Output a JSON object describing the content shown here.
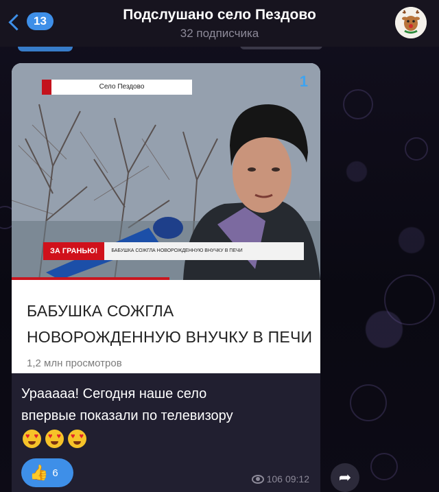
{
  "header": {
    "back_count": "13",
    "title": "Подслушано село Пездово",
    "subtitle": "32 подписчика"
  },
  "post": {
    "media": {
      "location_tag": "Село Пездово",
      "ticker_label": "ЗА ГРАНЬЮ!",
      "ticker_text": "БАБУШКА СОЖГЛА НОВОРОЖДЕННУЮ ВНУЧКУ В ПЕЧИ",
      "headline_line1": "БАБУШКА СОЖГЛА",
      "headline_line2": "НОВОРОЖДЕННУЮ ВНУЧКУ В ПЕЧИ",
      "views_text": "1,2 млн просмотров"
    },
    "caption_line1": "Урааааа! Сегодня наше село",
    "caption_line2": "впервые показали по телевизору",
    "reaction": {
      "icon": "thumbs-up-icon",
      "count": "6"
    },
    "views": "106",
    "time": "09:12"
  },
  "colors": {
    "accent": "#3e8fe8",
    "bubble": "#211f30",
    "header": "#17141f",
    "news_red": "#d0111b"
  }
}
